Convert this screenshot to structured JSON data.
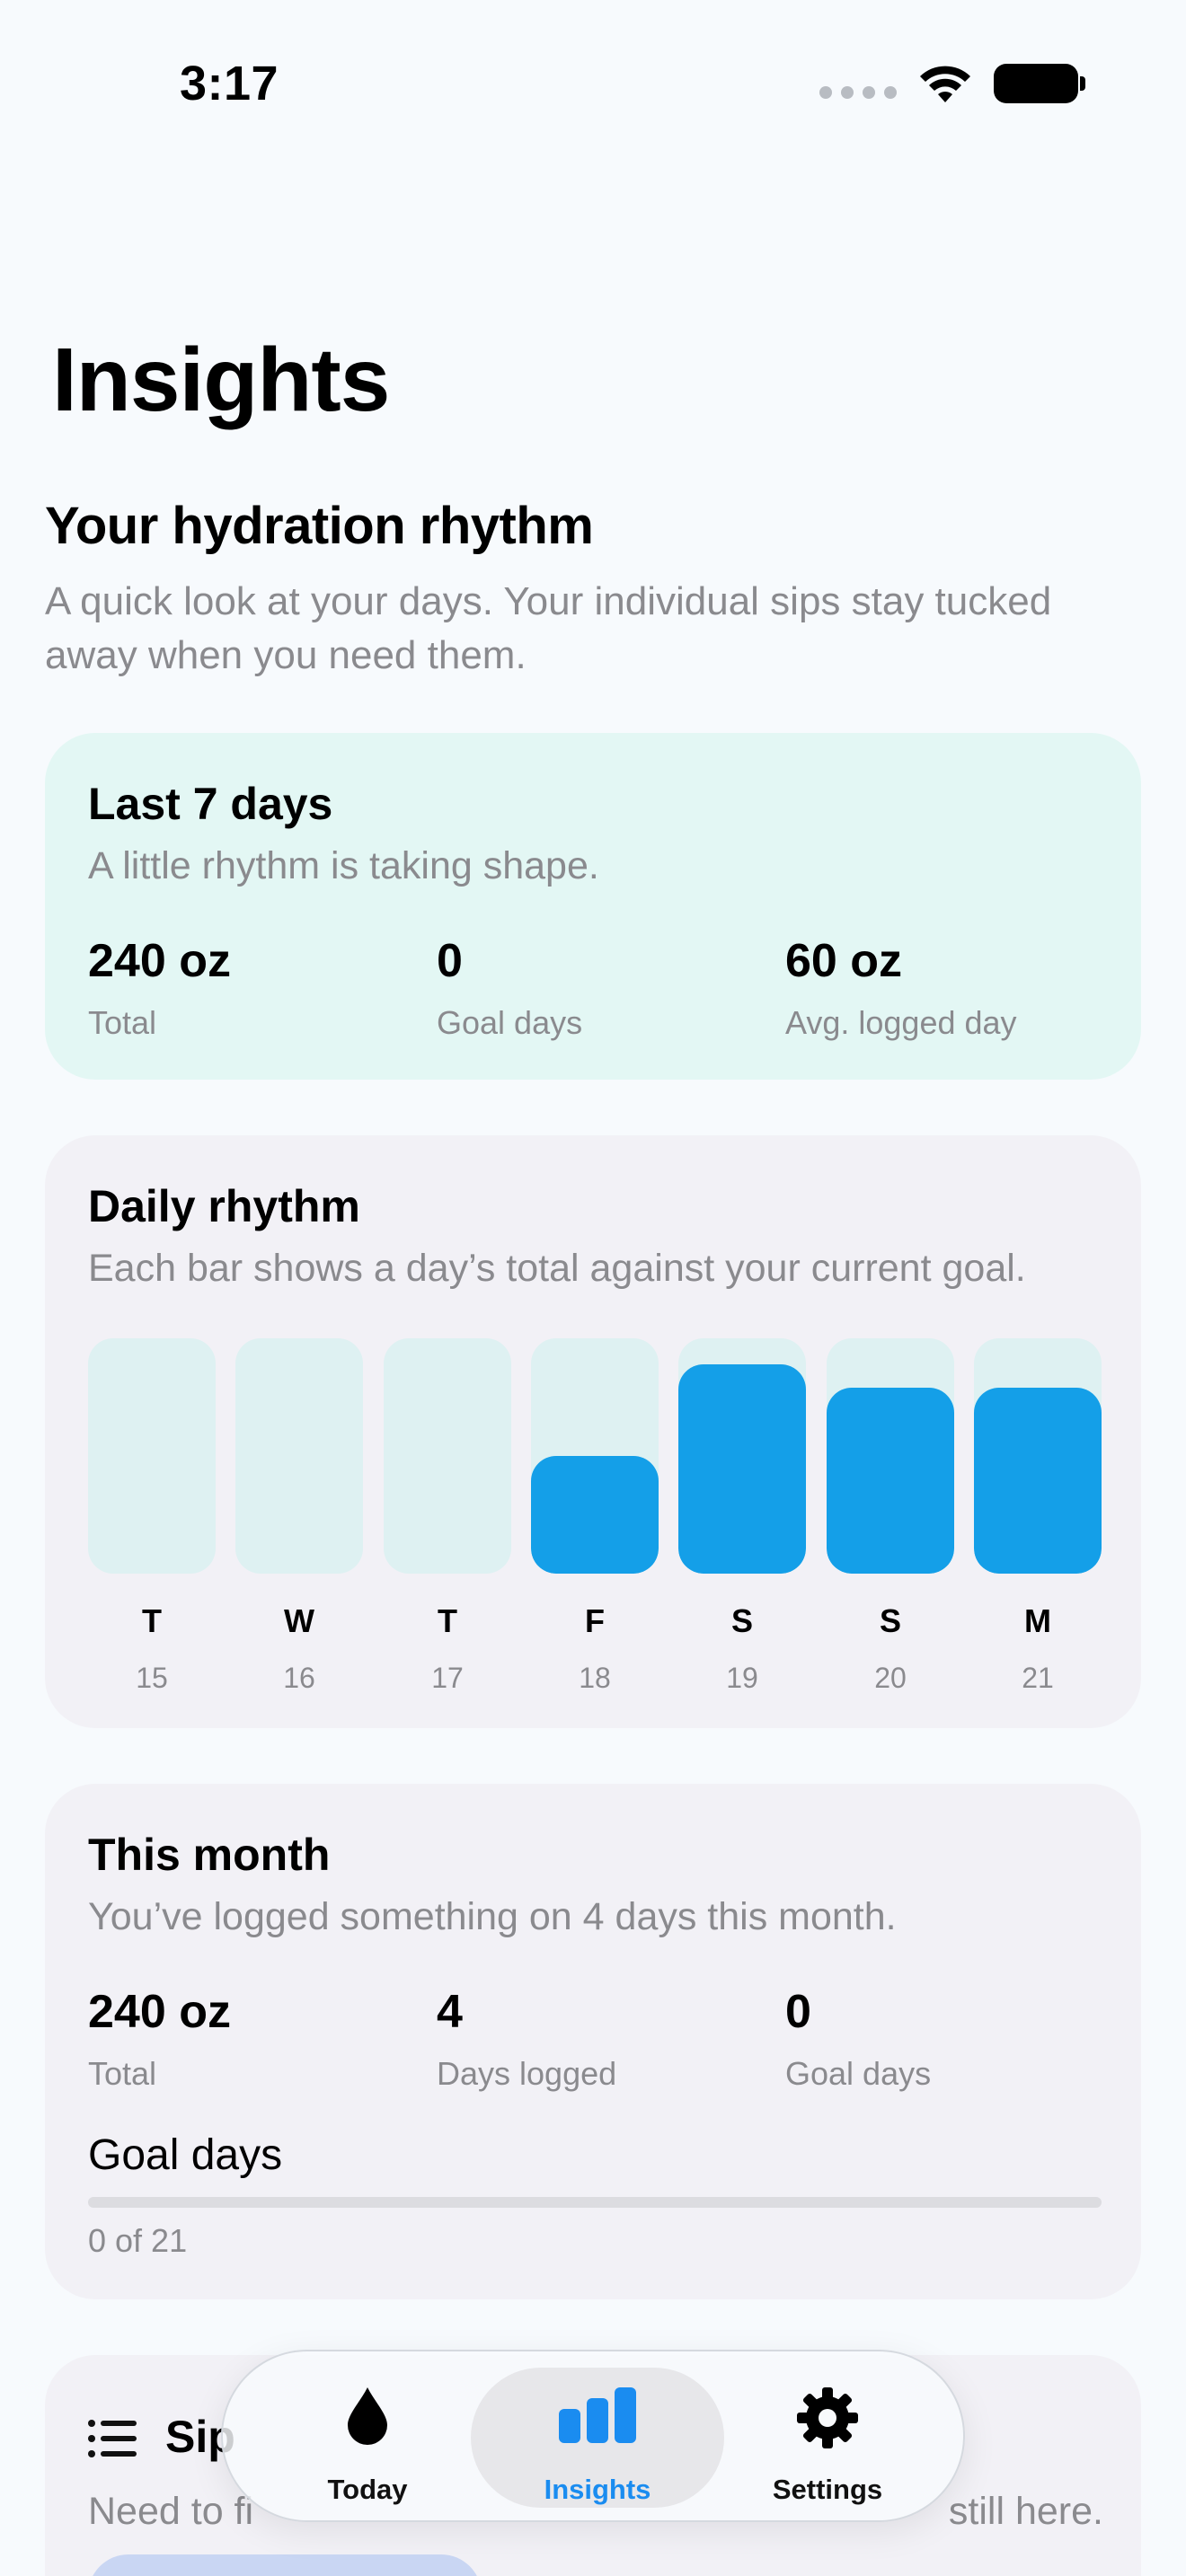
{
  "status_bar": {
    "time": "3:17"
  },
  "page": {
    "title": "Insights"
  },
  "intro": {
    "heading": "Your hydration rhythm",
    "subtitle": "A quick look at your days. Your individual sips stay tucked away when you need them."
  },
  "week_card": {
    "title": "Last 7 days",
    "subtitle": "A little rhythm is taking shape.",
    "stats": [
      {
        "value": "240 oz",
        "label": "Total"
      },
      {
        "value": "0",
        "label": "Goal days"
      },
      {
        "value": "60 oz",
        "label": "Avg. logged day"
      }
    ]
  },
  "rhythm_card": {
    "title": "Daily rhythm",
    "subtitle": "Each bar shows a day’s total against your current goal."
  },
  "chart_data": {
    "type": "bar",
    "categories": [
      "T",
      "W",
      "T",
      "F",
      "S",
      "S",
      "M"
    ],
    "dates": [
      "15",
      "16",
      "17",
      "18",
      "19",
      "20",
      "21"
    ],
    "values": [
      0,
      0,
      0,
      0.5,
      0.89,
      0.79,
      0.79
    ],
    "ylim": [
      0,
      1
    ],
    "colors": {
      "fill": "#149fe8",
      "track": "#def1f2"
    }
  },
  "month_card": {
    "title": "This month",
    "subtitle": "You’ve logged something on 4 days this month.",
    "stats": [
      {
        "value": "240 oz",
        "label": "Total"
      },
      {
        "value": "4",
        "label": "Days logged"
      },
      {
        "value": "0",
        "label": "Goal days"
      }
    ],
    "goal_label": "Goal days",
    "goal_count": "0 of 21",
    "goal_progress": 0
  },
  "sips_card": {
    "title": "Sip",
    "subtitle": "Need to fi",
    "subtitle_tail": "still here."
  },
  "tab_bar": {
    "tabs": [
      {
        "label": "Today",
        "icon": "drop-icon"
      },
      {
        "label": "Insights",
        "icon": "bar-chart-icon"
      },
      {
        "label": "Settings",
        "icon": "gear-icon"
      }
    ],
    "active": "Insights"
  },
  "colors": {
    "accent": "#149fe8",
    "active_tab": "#1a8cf0",
    "week_card_bg": "#e3f7f4",
    "card_bg": "#f2f1f6"
  }
}
